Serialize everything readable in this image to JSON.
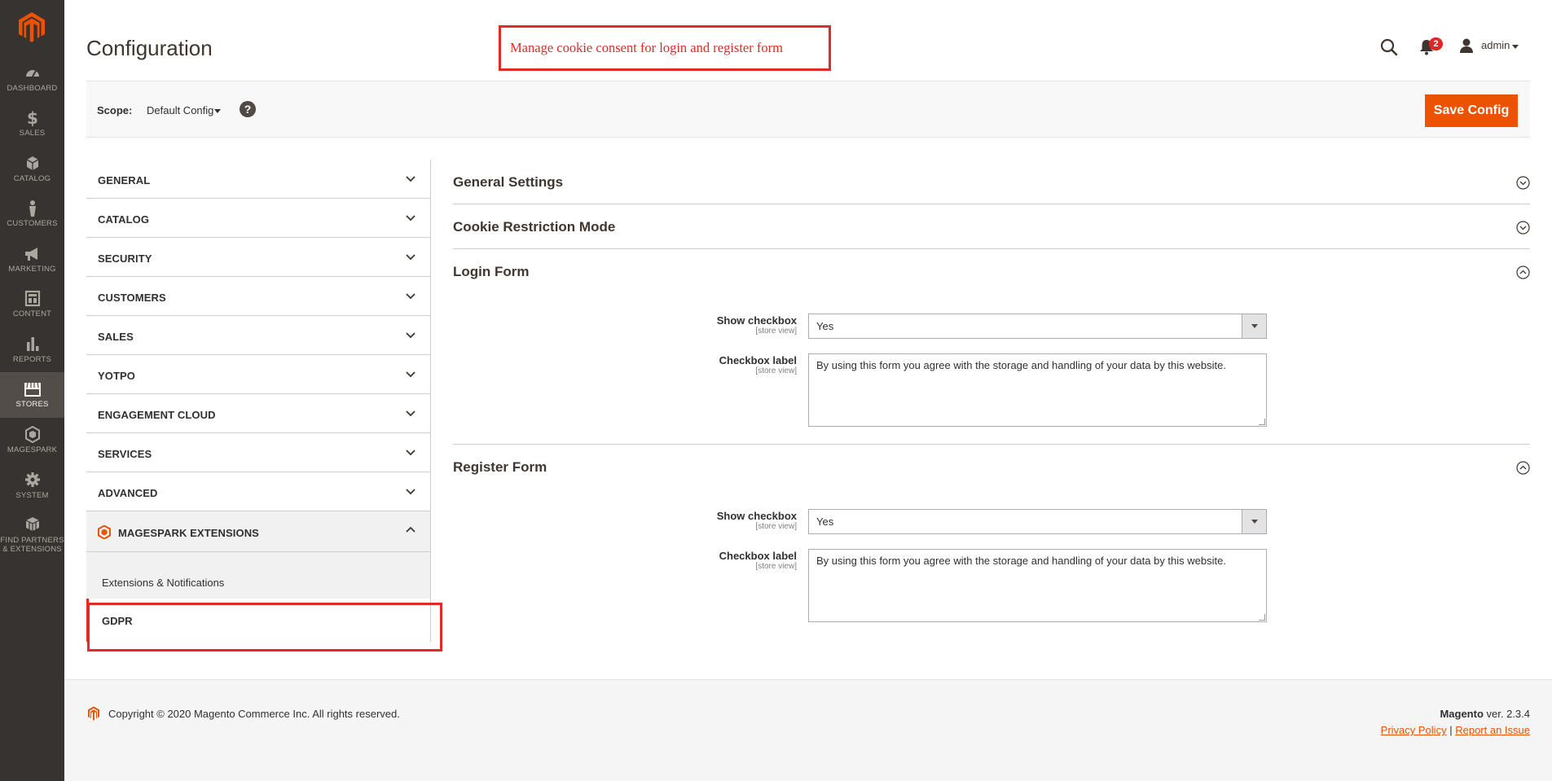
{
  "annotation": "Manage cookie consent for login and register form",
  "header": {
    "title": "Configuration",
    "notifications_count": "2",
    "user": "admin"
  },
  "sidebar": {
    "items": [
      {
        "label": "DASHBOARD",
        "icon": "dashboard-icon"
      },
      {
        "label": "SALES",
        "icon": "dollar-icon"
      },
      {
        "label": "CATALOG",
        "icon": "cube-icon"
      },
      {
        "label": "CUSTOMERS",
        "icon": "person-icon"
      },
      {
        "label": "MARKETING",
        "icon": "megaphone-icon"
      },
      {
        "label": "CONTENT",
        "icon": "layout-icon"
      },
      {
        "label": "REPORTS",
        "icon": "bar-chart-icon"
      },
      {
        "label": "STORES",
        "icon": "store-icon"
      },
      {
        "label": "MAGESPARK",
        "icon": "magespark-icon"
      },
      {
        "label": "SYSTEM",
        "icon": "gear-icon"
      },
      {
        "label": "FIND PARTNERS",
        "label2": "& EXTENSIONS",
        "icon": "boxes-icon"
      }
    ]
  },
  "scope": {
    "label": "Scope:",
    "value": "Default Config"
  },
  "toolbar": {
    "save_label": "Save Config"
  },
  "tabs": {
    "items": [
      {
        "label": "GENERAL"
      },
      {
        "label": "CATALOG"
      },
      {
        "label": "SECURITY"
      },
      {
        "label": "CUSTOMERS"
      },
      {
        "label": "SALES"
      },
      {
        "label": "YOTPO"
      },
      {
        "label": "ENGAGEMENT CLOUD"
      },
      {
        "label": "SERVICES"
      },
      {
        "label": "ADVANCED"
      },
      {
        "label": "MAGESPARK EXTENSIONS"
      }
    ],
    "sub": [
      {
        "label": "Extensions & Notifications"
      },
      {
        "label": "GDPR"
      }
    ]
  },
  "sections": {
    "general": "General Settings",
    "cookie": "Cookie Restriction Mode",
    "login": {
      "title": "Login Form",
      "show_checkbox_label": "Show checkbox",
      "show_checkbox_scope": "[store view]",
      "show_checkbox_value": "Yes",
      "checkbox_label_label": "Checkbox label",
      "checkbox_label_scope": "[store view]",
      "checkbox_label_value": "By using this form you agree with the storage and handling of your data by this website."
    },
    "register": {
      "title": "Register Form",
      "show_checkbox_label": "Show checkbox",
      "show_checkbox_scope": "[store view]",
      "show_checkbox_value": "Yes",
      "checkbox_label_label": "Checkbox label",
      "checkbox_label_scope": "[store view]",
      "checkbox_label_value": "By using this form you agree with the storage and handling of your data by this website."
    }
  },
  "footer": {
    "copyright": "Copyright © 2020 Magento Commerce Inc. All rights reserved.",
    "brand": "Magento",
    "version": "ver. 2.3.4",
    "privacy": "Privacy Policy",
    "separator": "|",
    "report": "Report an Issue"
  },
  "colors": {
    "sidebar_bg": "#373330",
    "accent": "#eb5202",
    "annotation": "#e02b27"
  }
}
